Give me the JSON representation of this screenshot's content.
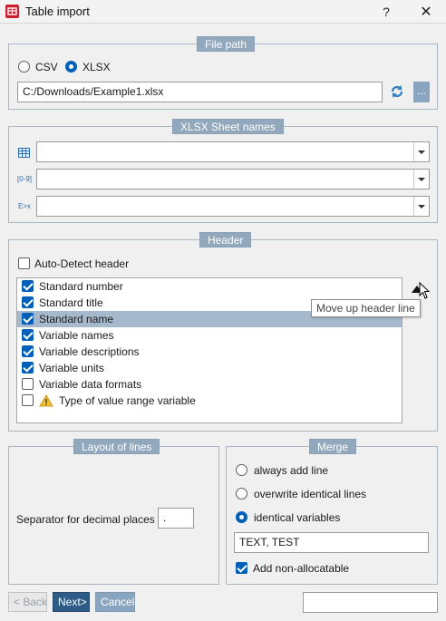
{
  "window": {
    "title": "Table import",
    "help_label": "?",
    "close_label": "✕"
  },
  "file_path": {
    "legend": "File path",
    "options": [
      {
        "label": "CSV",
        "checked": false
      },
      {
        "label": "XLSX",
        "checked": true
      }
    ],
    "path_value": "C:/Downloads/Example1.xlsx",
    "refresh_icon": "refresh-icon",
    "browse_label": "..."
  },
  "sheet_names": {
    "legend": "XLSX Sheet names",
    "rows": [
      {
        "icon": "table-icon",
        "icon_text": "",
        "value": ""
      },
      {
        "icon": "range-icon",
        "icon_text": "[0-9]",
        "value": ""
      },
      {
        "icon": "regex-icon",
        "icon_text": "E>x",
        "value": ""
      }
    ]
  },
  "header": {
    "legend": "Header",
    "auto_detect": {
      "label": "Auto-Detect header",
      "checked": false
    },
    "lines": [
      {
        "label": "Standard number",
        "checked": true,
        "selected": false
      },
      {
        "label": "Standard title",
        "checked": true,
        "selected": false
      },
      {
        "label": "Standard name",
        "checked": true,
        "selected": true
      },
      {
        "label": "Variable names",
        "checked": true,
        "selected": false
      },
      {
        "label": "Variable descriptions",
        "checked": true,
        "selected": false
      },
      {
        "label": "Variable units",
        "checked": true,
        "selected": false
      },
      {
        "label": "Variable data formats",
        "checked": false,
        "selected": false
      },
      {
        "label": "Type of value range variable",
        "checked": false,
        "selected": false,
        "icon": "warning-icon"
      }
    ],
    "move_up_tooltip": "Move up header line"
  },
  "layout_of_lines": {
    "legend": "Layout of lines",
    "separator_label": "Separator for decimal places",
    "separator_value": "."
  },
  "merge": {
    "legend": "Merge",
    "options": [
      {
        "label": "always add line",
        "checked": false
      },
      {
        "label": "overwrite identical lines",
        "checked": false
      },
      {
        "label": "identical variables",
        "checked": true
      }
    ],
    "variables_value": "TEXT, TEST",
    "add_non_allocatable": {
      "label": "Add non-allocatable",
      "checked": true
    }
  },
  "footer": {
    "back_label": "< Back",
    "next_label": "Next>",
    "cancel_label": "Cancel",
    "status_value": ""
  },
  "colors": {
    "accent": "#005fb8",
    "legend_bg": "#92a8bd",
    "selected_row": "#a6b9cc",
    "next_button": "#2e5c86",
    "brand_red": "#c8202f"
  }
}
